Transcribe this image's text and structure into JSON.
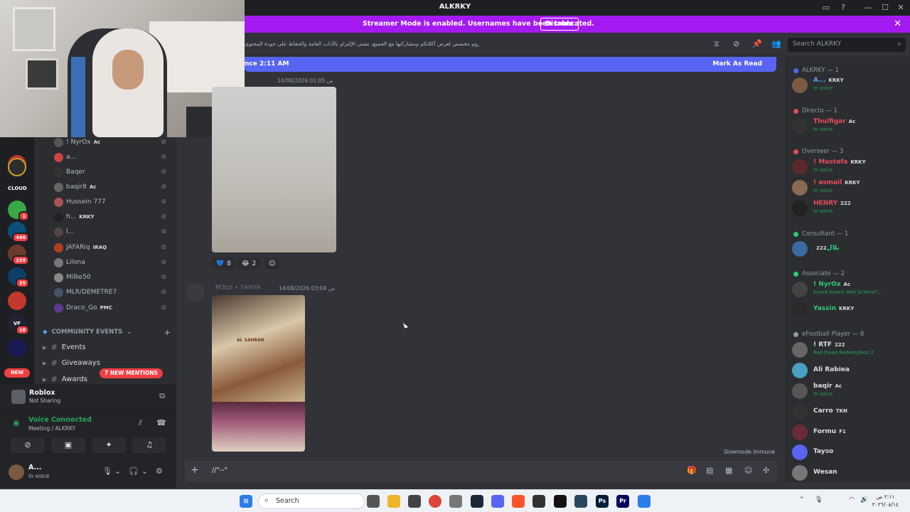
{
  "window": {
    "title": "ALKRKY"
  },
  "banner": {
    "text": "Streamer Mode is enabled. Usernames have been truncated.",
    "button": "Disable"
  },
  "rail": {
    "new_label": "NEW",
    "servers": [
      {
        "label": "",
        "badge": ""
      },
      {
        "label": "CLOUD",
        "badge": ""
      },
      {
        "label": "",
        "badge": "1"
      },
      {
        "label": "",
        "badge": "488"
      },
      {
        "label": "",
        "badge": "229"
      },
      {
        "label": "",
        "badge": "25"
      },
      {
        "label": "",
        "badge": ""
      },
      {
        "label": "VF",
        "badge": "18"
      }
    ]
  },
  "voice_users": [
    {
      "name": "! NyrOx",
      "tag": "Ac"
    },
    {
      "name": "a...",
      "tag": ""
    },
    {
      "name": "Baqer",
      "tag": ""
    },
    {
      "name": "baqir8",
      "tag": "Ac"
    },
    {
      "name": "Hussein 777",
      "tag": ""
    },
    {
      "name": "h...",
      "tag": "KRKY"
    },
    {
      "name": "I...",
      "tag": ""
    },
    {
      "name": "JAFARiq",
      "tag": "IRAQ"
    },
    {
      "name": "Lilona",
      "tag": ""
    },
    {
      "name": "Milke50",
      "tag": ""
    },
    {
      "name": "MLR/DEMETRE7",
      "tag": ""
    },
    {
      "name": "Draco_Go",
      "tag": "PMC"
    }
  ],
  "channels": {
    "category": "COMMUNITY EVENTS",
    "items": [
      {
        "label": "Events"
      },
      {
        "label": "Giveaways"
      },
      {
        "label": "Awards"
      }
    ],
    "mentions": "7 NEW MENTIONS"
  },
  "activity": {
    "title": "Roblox",
    "subtitle": "Not Sharing"
  },
  "voice": {
    "status": "Voice Connected",
    "channel": "Meeting / ALKRKY"
  },
  "user": {
    "name": "A...",
    "status": "In voice"
  },
  "chat": {
    "topic": "هذا الروم مخصص لعرض أكلاتكم ومشاركتها مع الجميع، نتمنى الإلتزام بالآداب العامة والحفاظ على جودة المحتوى.",
    "search_placeholder": "Search ALKRKY",
    "new_bar_left": "nce 2:11 AM",
    "new_bar_right": "Mark As Read",
    "msg1_meta": "14/08/2026 01:05 ص",
    "msg2_name": "M3tzl • YAHYA",
    "msg2_meta": "14/08/2026 03:04 ص",
    "reactions": [
      {
        "emoji": "💙",
        "count": "8"
      },
      {
        "emoji": "😂",
        "count": "2"
      }
    ],
    "slowmode": "Slowmode Immune",
    "composer_text": "//\"--\"",
    "image_label": "AL SAHRAN"
  },
  "members": {
    "groups": [
      {
        "label": "ALKRKY — 1",
        "color": "#5865f2"
      },
      {
        "label": "Directo — 1",
        "color": "#e74c5a"
      },
      {
        "label": "Overseer — 3",
        "color": "#e74c5a"
      },
      {
        "label": "Consultant — 1",
        "color": "#2ecc71"
      },
      {
        "label": "Associate — 2",
        "color": "#2ecc71"
      },
      {
        "label": "eFootball Player — 8",
        "color": "#949ba4"
      }
    ],
    "list": [
      {
        "name": "A...",
        "tag": "KRKY",
        "status": "In voice",
        "color": "#5aa0f0"
      },
      {
        "name": "Thulfigar",
        "tag": "Ac",
        "status": "In voice",
        "color": "#e74c5a"
      },
      {
        "name": "! Mustafa",
        "tag": "KRKY",
        "status": "In voice",
        "color": "#e74c5a"
      },
      {
        "name": "! asmail",
        "tag": "KRKY",
        "status": "In voice",
        "color": "#e74c5a"
      },
      {
        "name": "HENRY",
        "tag": "222",
        "status": "In voice",
        "color": "#e74c5a"
      },
      {
        "name": "بلال",
        "tag": "222",
        "status": "",
        "color": "#2ecc71"
      },
      {
        "name": "! NyrOx",
        "tag": "Ac",
        "status": "knock knock who is here?...",
        "color": "#2ecc71"
      },
      {
        "name": "Yassin",
        "tag": "KRKY",
        "status": "",
        "color": "#2ecc71"
      },
      {
        "name": "! RTF",
        "tag": "222",
        "status": "Red Dead Redemption 2",
        "color": "#dbdee1"
      },
      {
        "name": "Ali Rabiea",
        "tag": "",
        "status": "",
        "color": "#dbdee1"
      },
      {
        "name": "baqir",
        "tag": "Ac",
        "status": "In voice",
        "color": "#dbdee1"
      },
      {
        "name": "Carro",
        "tag": "TKN",
        "status": "",
        "color": "#dbdee1"
      },
      {
        "name": "Formu",
        "tag": "F1",
        "status": "",
        "color": "#dbdee1"
      },
      {
        "name": "Tayso",
        "tag": "",
        "status": "",
        "color": "#dbdee1"
      },
      {
        "name": "Wesan",
        "tag": "",
        "status": "",
        "color": "#dbdee1"
      }
    ]
  },
  "taskbar": {
    "search": "Search",
    "time": "٢:١١ ص",
    "date": "٢٠٢٦/٠٨/١٤"
  }
}
